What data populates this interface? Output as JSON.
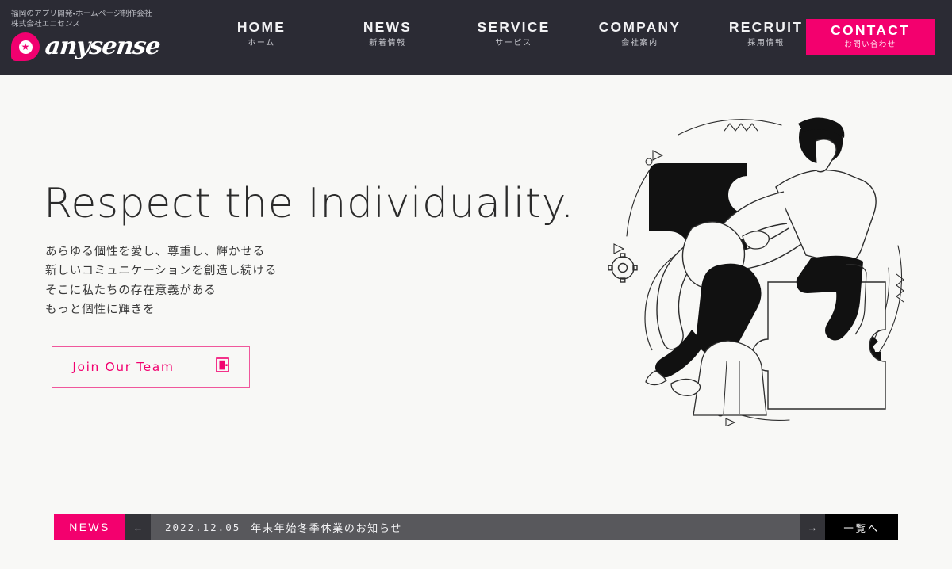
{
  "header": {
    "tagline_line1": "福岡のアプリ開発・ホームページ制作会社",
    "tagline_line2": "株式会社エニセンス",
    "logo_text": "anysense",
    "logo_icon": "star-speech-bubble-icon",
    "background_color": "#2b2b34",
    "nav": [
      {
        "en": "HOME",
        "ja": "ホーム"
      },
      {
        "en": "NEWS",
        "ja": "新着情報"
      },
      {
        "en": "SERVICE",
        "ja": "サービス"
      },
      {
        "en": "COMPANY",
        "ja": "会社案内"
      },
      {
        "en": "RECRUIT",
        "ja": "採用情報"
      }
    ],
    "contact": {
      "en": "CONTACT",
      "ja": "お問い合わせ",
      "color": "#f3006e"
    }
  },
  "hero": {
    "title": "Respect the Individuality.",
    "copy": [
      "あらゆる個性を愛し、尊重し、輝かせる",
      "新しいコミュニケーションを創造し続ける",
      "そこに私たちの存在意義がある",
      "もっと個性に輝きを"
    ],
    "cta": {
      "label": "Join Our Team",
      "icon": "door-icon",
      "color": "#f2006f"
    },
    "illustration_alt": "二人がパズルのピースを組み合わせるイラスト"
  },
  "news": {
    "label": "NEWS",
    "prev_arrow": "←",
    "next_arrow": "→",
    "date": "2022.12.05",
    "title": "年末年始冬季休業のお知らせ",
    "more_label": "一覧へ",
    "accent_color": "#f3006e",
    "body_color": "#58585c"
  },
  "theme": {
    "page_background": "#f8f8f6",
    "accent_pink": "#f3006e",
    "dark": "#2b2b34"
  }
}
